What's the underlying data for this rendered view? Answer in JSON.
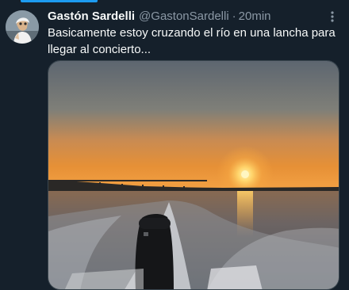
{
  "tweet": {
    "display_name": "Gastón Sardelli",
    "handle": "@GastonSardelli",
    "separator": "·",
    "time": "20min",
    "text": "Basicamente estoy cruzando el río en una lancha para llegar al concierto..."
  },
  "icons": {
    "more": "more-vertical-icon",
    "avatar": "avatar-image"
  },
  "colors": {
    "background": "#15202b",
    "accent": "#1d9bf0",
    "text_primary": "#f7f9f9",
    "text_secondary": "#8b98a5"
  }
}
